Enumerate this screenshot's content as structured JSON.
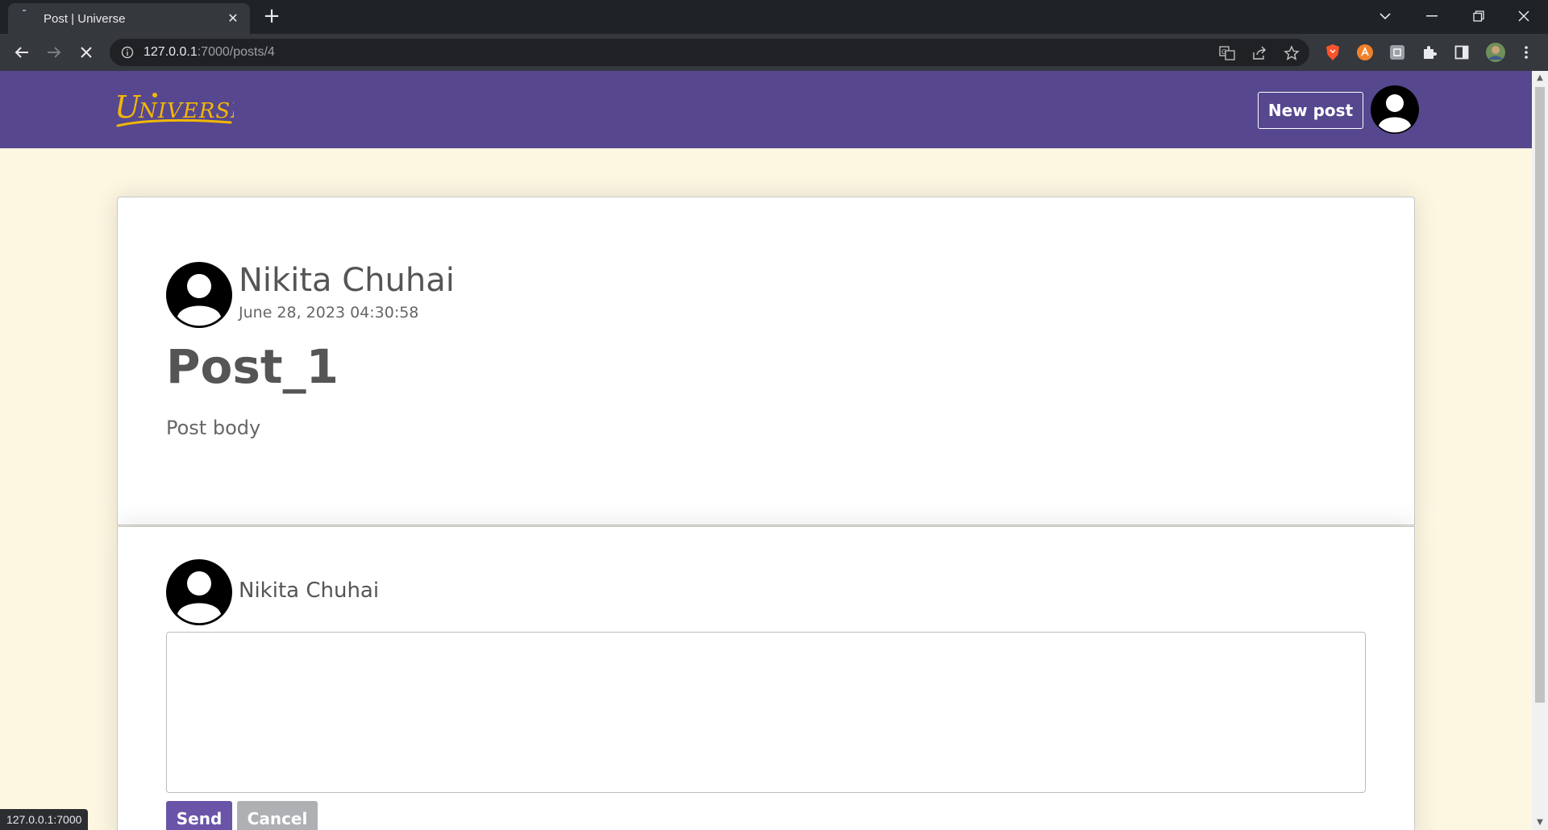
{
  "browser": {
    "tab_title": "Post | Universe",
    "url_host": "127.0.0.1",
    "url_rest": ":7000/posts/4",
    "status_url": "127.0.0.1:7000"
  },
  "header": {
    "logo_text": "UNIVERSE",
    "new_post_label": "New post"
  },
  "post": {
    "author": "Nikita Chuhai",
    "date": "June 28, 2023 04:30:58",
    "title": "Post_1",
    "body": "Post body"
  },
  "comment_form": {
    "author": "Nikita Chuhai",
    "input_value": "",
    "send_label": "Send",
    "cancel_label": "Cancel"
  },
  "colors": {
    "header_bg": "#56478f",
    "page_bg": "#fdf6e1",
    "logo": "#f2b705",
    "send_bg": "#6a54a8",
    "cancel_bg": "#aeb0b3"
  }
}
